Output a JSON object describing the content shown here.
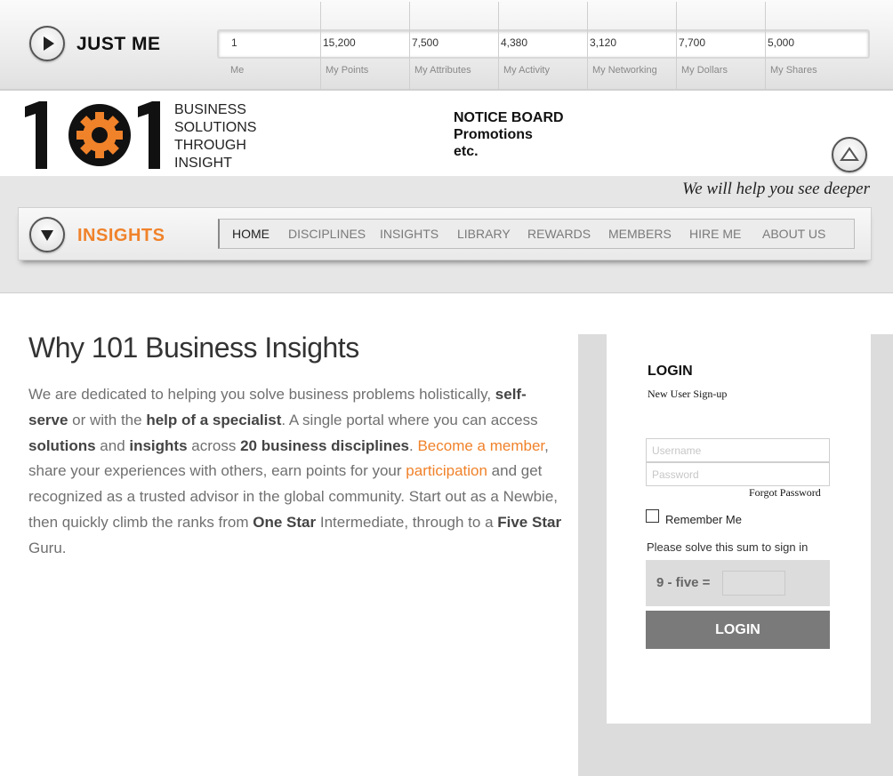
{
  "topbar": {
    "title": "JUST ME",
    "stats": [
      {
        "value": "1",
        "label": "Me"
      },
      {
        "value": "15,200",
        "label": "My Points"
      },
      {
        "value": "7,500",
        "label": "My Attributes"
      },
      {
        "value": "4,380",
        "label": "My Activity"
      },
      {
        "value": "3,120",
        "label": "My Networking"
      },
      {
        "value": "7,700",
        "label": "My Dollars"
      },
      {
        "value": "5,000",
        "label": "My Shares"
      }
    ]
  },
  "logo": {
    "mark": "101",
    "tagline": [
      "BUSINESS",
      "SOLUTIONS",
      "THROUGH",
      "INSIGHT"
    ]
  },
  "notice": {
    "title": "NOTICE BOARD",
    "lines": [
      "Promotions",
      "etc."
    ]
  },
  "banner": {
    "slogan": "We will help you see deeper",
    "section_title": "INSIGHTS"
  },
  "nav": {
    "items": [
      "HOME",
      "DISCIPLINES",
      "INSIGHTS",
      "LIBRARY",
      "REWARDS",
      "MEMBERS",
      "HIRE ME",
      "ABOUT US"
    ],
    "active": "HOME"
  },
  "main": {
    "heading": "Why 101 Business Insights",
    "intro": [
      {
        "t": "We are dedicated to helping you solve business problems holistically, ",
        "s": "n"
      },
      {
        "t": "self-serve",
        "s": "b"
      },
      {
        "t": " or with the ",
        "s": "n"
      },
      {
        "t": "help of a specialist",
        "s": "b"
      },
      {
        "t": ". A single portal where you can access ",
        "s": "n"
      },
      {
        "t": "solutions",
        "s": "b"
      },
      {
        "t": " and ",
        "s": "n"
      },
      {
        "t": "insights",
        "s": "b"
      },
      {
        "t": " across ",
        "s": "n"
      },
      {
        "t": "20 business disciplines",
        "s": "b"
      },
      {
        "t": ". ",
        "s": "n"
      },
      {
        "t": "Become a member",
        "s": "o"
      },
      {
        "t": ", share your experiences with others, earn points for your ",
        "s": "n"
      },
      {
        "t": "participation",
        "s": "o"
      },
      {
        "t": " and get recognized as a trusted advisor in the global community. Start out as a Newbie, then quickly climb the ranks from ",
        "s": "n"
      },
      {
        "t": "One Star",
        "s": "b"
      },
      {
        "t": " Intermediate, through to a ",
        "s": "n"
      },
      {
        "t": "Five Star",
        "s": "b"
      },
      {
        "t": " Guru.",
        "s": "n"
      }
    ]
  },
  "login": {
    "title": "LOGIN",
    "signup": "New User Sign-up",
    "username_placeholder": "Username",
    "password_placeholder": "Password",
    "forgot": "Forgot Password",
    "remember": "Remember Me",
    "solve_prompt": "Please solve this sum to sign in",
    "captcha_question": "9 - five =",
    "button": "LOGIN"
  },
  "colors": {
    "accent": "#f0822a",
    "button_grey": "#7a7a7a",
    "panel_grey": "#dcdcdc"
  }
}
